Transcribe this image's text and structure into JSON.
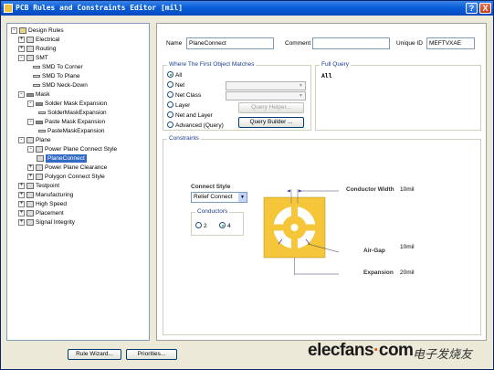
{
  "window": {
    "title": "PCB Rules and Constraints Editor [mil]",
    "help_label": "?",
    "close_label": "X"
  },
  "tree": [
    {
      "label": "Design Rules",
      "expander": "-"
    },
    {
      "label": "Electrical",
      "expander": "+"
    },
    {
      "label": "Routing",
      "expander": "+"
    },
    {
      "label": "SMT",
      "expander": "-"
    },
    {
      "label": "SMD To Corner",
      "expander": ""
    },
    {
      "label": "SMD To Plane",
      "expander": ""
    },
    {
      "label": "SMD Neck-Down",
      "expander": ""
    },
    {
      "label": "Mask",
      "expander": "-"
    },
    {
      "label": "Solder Mask Expansion",
      "expander": "-"
    },
    {
      "label": "SolderMaskExpansion",
      "expander": ""
    },
    {
      "label": "Paste Mask Expansion",
      "expander": "-"
    },
    {
      "label": "PasteMaskExpansion",
      "expander": ""
    },
    {
      "label": "Plane",
      "expander": "-"
    },
    {
      "label": "Power Plane Connect Style",
      "expander": "-"
    },
    {
      "label": "PlaneConnect",
      "expander": ""
    },
    {
      "label": "Power Plane Clearance",
      "expander": "+"
    },
    {
      "label": "Polygon Connect Style",
      "expander": "+"
    },
    {
      "label": "Testpoint",
      "expander": "+"
    },
    {
      "label": "Manufacturing",
      "expander": "+"
    },
    {
      "label": "High Speed",
      "expander": "+"
    },
    {
      "label": "Placement",
      "expander": "+"
    },
    {
      "label": "Signal Integrity",
      "expander": "+"
    }
  ],
  "header": {
    "name_label": "Name",
    "name_value": "PlaneConnect",
    "comment_label": "Comment",
    "comment_value": "",
    "uid_label": "Unique ID",
    "uid_value": "MEFTVXAE"
  },
  "where": {
    "title": "Where The First Object Matches",
    "options": [
      "All",
      "Net",
      "Net Class",
      "Layer",
      "Net and Layer",
      "Advanced (Query)"
    ],
    "selected": "All",
    "query_helper_label": "Query Helper...",
    "query_builder_label": "Query Builder ..."
  },
  "full_query": {
    "title": "Full Query",
    "value": "All"
  },
  "constraints": {
    "title": "Constraints",
    "connect_style_label": "Connect Style",
    "connect_style_value": "Relief Connect",
    "conductors_label": "Conductors",
    "conductor_options": [
      "2",
      "4"
    ],
    "conductor_selected": "4",
    "conductor_width_label": "Conductor Width",
    "conductor_width_value": "10mil",
    "air_gap_label": "Air-Gap",
    "air_gap_value": "10mil",
    "expansion_label": "Expansion",
    "expansion_value": "20mil",
    "pad_color": "#f5c53a"
  },
  "footer": {
    "rule_wizard_label": "Rule Wizard...",
    "priorities_label": "Priorities...",
    "watermark_brand": "elecfans",
    "watermark_dot": "·",
    "watermark_suffix": "com",
    "watermark_cn": "电子发烧友"
  }
}
